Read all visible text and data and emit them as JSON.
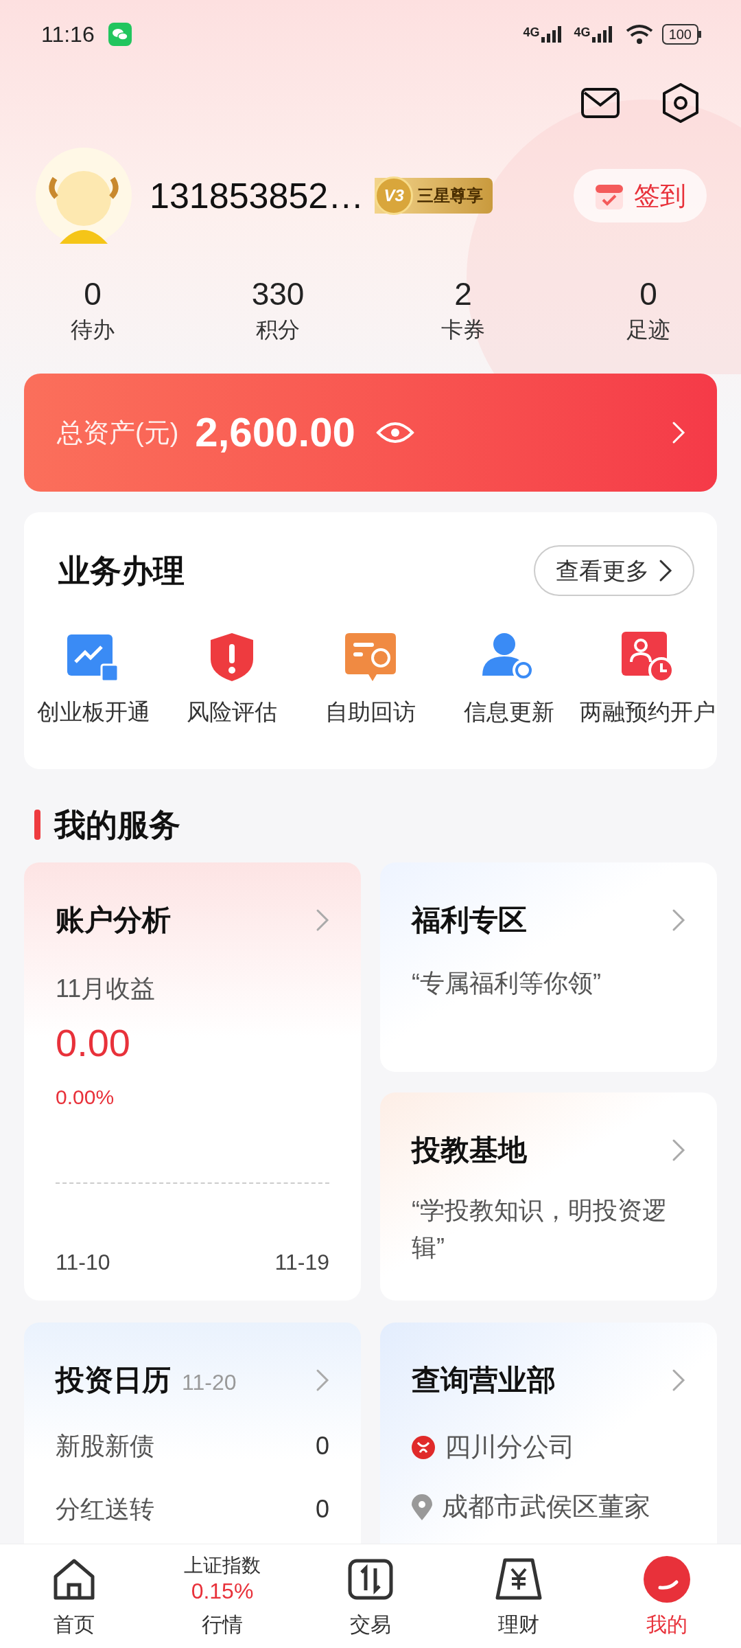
{
  "status_bar": {
    "time": "11:16",
    "networks": [
      "4G",
      "4G"
    ],
    "battery": "100"
  },
  "profile": {
    "name": "131853852…",
    "badge_level": "V3",
    "badge_label": "三星尊享",
    "sign_in": "签到"
  },
  "stats": [
    {
      "value": "0",
      "label": "待办"
    },
    {
      "value": "330",
      "label": "积分"
    },
    {
      "value": "2",
      "label": "卡券"
    },
    {
      "value": "0",
      "label": "足迹"
    }
  ],
  "assets": {
    "label": "总资产(元)",
    "amount": "2,600.00"
  },
  "business": {
    "title": "业务办理",
    "more": "查看更多",
    "items": [
      {
        "label": "创业板开通",
        "kind": "growth"
      },
      {
        "label": "风险评估",
        "kind": "shield"
      },
      {
        "label": "自助回访",
        "kind": "message"
      },
      {
        "label": "信息更新",
        "kind": "user_sync"
      },
      {
        "label": "两融预约开户",
        "kind": "user_clock"
      }
    ]
  },
  "services": {
    "title": "我的服务",
    "account_analysis": {
      "title": "账户分析",
      "period": "11月收益",
      "amount": "0.00",
      "rate": "0.00%",
      "start_date": "11-10",
      "end_date": "11-19"
    },
    "welfare": {
      "title": "福利专区",
      "slogan": "“专属福利等你领”"
    },
    "education": {
      "title": "投教基地",
      "slogan": "“学投教知识，明投资逻辑”"
    },
    "calendar": {
      "title": "投资日历",
      "date": "11-20",
      "rows": [
        {
          "label": "新股新债",
          "count": "0"
        },
        {
          "label": "分红送转",
          "count": "0"
        }
      ]
    },
    "branch": {
      "title": "查询营业部",
      "name": "四川分公司",
      "address": "成都市武侯区董家"
    }
  },
  "nav": [
    {
      "kind": "home",
      "label": "首页",
      "selected": false
    },
    {
      "kind": "market",
      "label": "行情",
      "index_name": "上证指数",
      "index_change": "0.15%",
      "selected": false
    },
    {
      "kind": "trade",
      "label": "交易",
      "selected": false
    },
    {
      "kind": "finance",
      "label": "理财",
      "selected": false
    },
    {
      "kind": "mine",
      "label": "我的",
      "selected": true
    }
  ]
}
